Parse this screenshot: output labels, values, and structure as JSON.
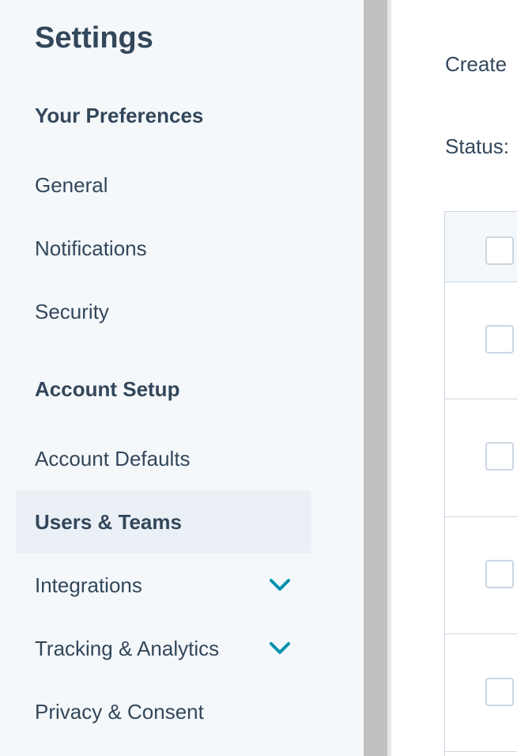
{
  "sidebar": {
    "title": "Settings",
    "sections": [
      {
        "heading": "Your Preferences",
        "items": [
          {
            "label": "General"
          },
          {
            "label": "Notifications"
          },
          {
            "label": "Security"
          }
        ]
      },
      {
        "heading": "Account Setup",
        "items": [
          {
            "label": "Account Defaults"
          },
          {
            "label": "Users & Teams",
            "active": true
          },
          {
            "label": "Integrations",
            "expandable": true
          },
          {
            "label": "Tracking & Analytics",
            "expandable": true
          },
          {
            "label": "Privacy & Consent"
          }
        ]
      }
    ]
  },
  "main": {
    "create_label": "Create",
    "status_label": "Status:"
  },
  "colors": {
    "sidebar_bg": "#f5f8fa",
    "active_bg": "#eaf0f6",
    "text": "#33475b",
    "chevron": "#0091ae",
    "border": "#cbd6e2",
    "scrollbar": "#c0c0c0"
  }
}
